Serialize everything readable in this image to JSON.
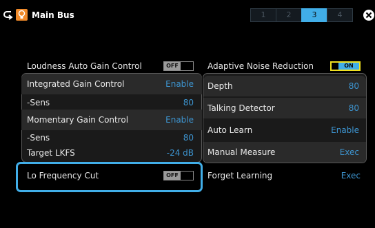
{
  "header": {
    "title": "Main Bus",
    "tabs": [
      "1",
      "2",
      "3",
      "4"
    ],
    "active_tab": "3",
    "accent_color": "#41aee8",
    "icons": [
      "return-icon",
      "bus-icon",
      "close-icon"
    ]
  },
  "left": {
    "loudness": {
      "label": "Loudness Auto Gain Control",
      "toggle": "OFF"
    },
    "items": [
      {
        "label": "Integrated Gain Control",
        "value": "Enable"
      },
      {
        "label": "-Sens",
        "value": "80"
      },
      {
        "label": "Momentary Gain Control",
        "value": "Enable"
      },
      {
        "label": "-Sens",
        "value": "80"
      },
      {
        "label": "Target LKFS",
        "value": "-24 dB"
      }
    ],
    "lo_cut": {
      "label": "Lo Frequency Cut",
      "toggle": "OFF"
    }
  },
  "right": {
    "adaptive": {
      "label": "Adaptive Noise Reduction",
      "toggle": "ON"
    },
    "items": [
      {
        "label": "Depth",
        "value": "80"
      },
      {
        "label": "Talking Detector",
        "value": "80"
      },
      {
        "label": "Auto Learn",
        "value": "Enable"
      },
      {
        "label": "Manual Measure",
        "value": "Exec"
      }
    ],
    "forget": {
      "label": "Forget Learning",
      "value": "Exec"
    }
  }
}
